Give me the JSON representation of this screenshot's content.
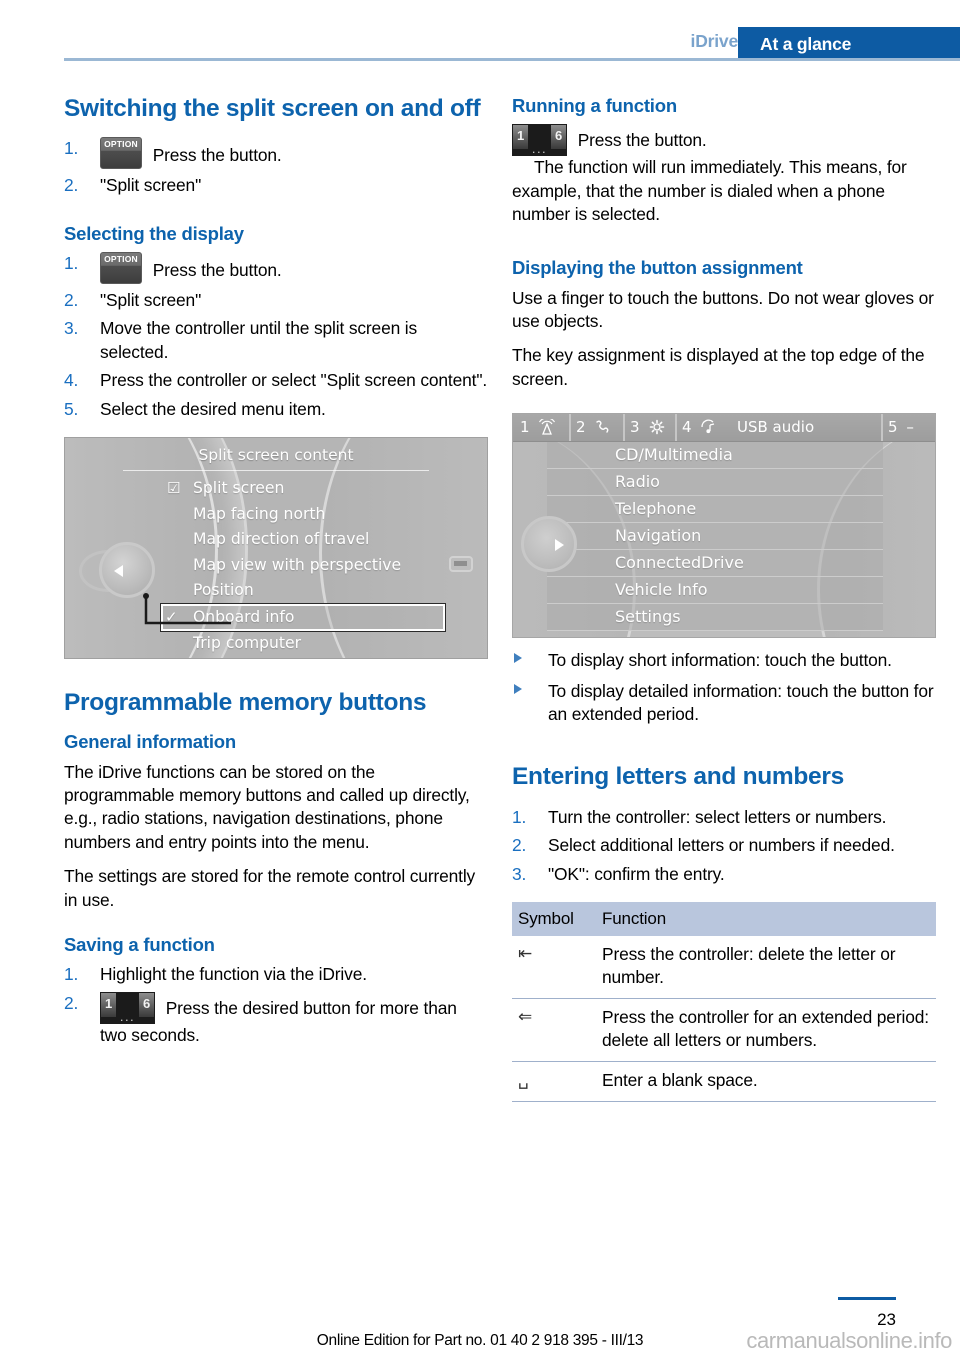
{
  "header": {
    "chapter": "iDrive",
    "tab": "At a glance"
  },
  "left_column": {
    "section1": {
      "title": "Switching the split screen on and off",
      "steps": [
        {
          "num": "1.",
          "icon": "option-button-icon",
          "text": "Press the button."
        },
        {
          "num": "2.",
          "text": "\"Split screen\""
        }
      ]
    },
    "section2": {
      "title": "Selecting the display",
      "steps": [
        {
          "num": "1.",
          "icon": "option-button-icon",
          "text": "Press the button."
        },
        {
          "num": "2.",
          "text": "\"Split screen\""
        },
        {
          "num": "3.",
          "text": "Move the controller until the split screen is selected."
        },
        {
          "num": "4.",
          "text": "Press the controller or select \"Split screen content\"."
        },
        {
          "num": "5.",
          "text": "Select the desired menu item."
        }
      ]
    },
    "screenshot": {
      "title": "Split screen content",
      "items": [
        {
          "label": "Split screen",
          "mark": "☑",
          "selected": false
        },
        {
          "label": "Map facing north",
          "mark": "",
          "selected": false
        },
        {
          "label": "Map direction of travel",
          "mark": "",
          "selected": false
        },
        {
          "label": "Map view with perspective",
          "mark": "",
          "selected": false
        },
        {
          "label": "Position",
          "mark": "",
          "selected": false
        },
        {
          "label": "Onboard info",
          "mark": "✓",
          "selected": true
        },
        {
          "label": "Trip computer",
          "mark": "",
          "selected": false
        }
      ]
    },
    "section3": {
      "title": "Programmable memory buttons",
      "sub1_title": "General information",
      "paragraphs": [
        "The iDrive functions can be stored on the programmable memory buttons and called up directly, e.g., radio stations, navigation destinations, phone numbers and entry points into the menu.",
        "The settings are stored for the remote control currently in use."
      ],
      "sub2_title": "Saving a function",
      "steps": [
        {
          "num": "1.",
          "text": "Highlight the function via the iDrive."
        },
        {
          "num": "2.",
          "icon": "memory-buttons-icon",
          "text": "Press the desired button for more than two seconds."
        }
      ]
    }
  },
  "right_column": {
    "section1": {
      "title": "Running a function",
      "icon": "memory-buttons-icon",
      "line1": "Press the button.",
      "paragraph": "The function will run immediately. This means, for example, that the number is dialed when a phone number is selected."
    },
    "section2": {
      "title": "Displaying the button assignment",
      "paragraphs": [
        "Use a finger to touch the buttons. Do not wear gloves or use objects.",
        "The key assignment is displayed at the top edge of the screen."
      ]
    },
    "screenshot": {
      "topbar": [
        {
          "num": "1",
          "icon": "antenna-icon"
        },
        {
          "num": "2",
          "icon": "telephone-icon"
        },
        {
          "num": "3",
          "icon": "gear-icon"
        },
        {
          "num": "4",
          "icon": "music-note-icon"
        }
      ],
      "topbar_label": "USB audio",
      "topbar_right": {
        "num": "5",
        "icon": "dash-icon",
        "dash": "–"
      },
      "items": [
        "CD/Multimedia",
        "Radio",
        "Telephone",
        "Navigation",
        "ConnectedDrive",
        "Vehicle Info",
        "Settings"
      ]
    },
    "bullets": [
      "To display short information: touch the button.",
      "To display detailed information: touch the button for an extended period."
    ],
    "section3": {
      "title": "Entering letters and numbers",
      "steps": [
        {
          "num": "1.",
          "text": "Turn the controller: select letters or numbers."
        },
        {
          "num": "2.",
          "text": "Select additional letters or numbers if needed."
        },
        {
          "num": "3.",
          "text": "\"OK\": confirm the entry."
        }
      ]
    },
    "table": {
      "headers": [
        "Symbol",
        "Function"
      ],
      "rows": [
        {
          "symbol": "⇤",
          "function": "Press the controller: delete the letter or number."
        },
        {
          "symbol": "⇐",
          "function": "Press the controller for an extended period: delete all letters or numbers."
        },
        {
          "symbol": "␣",
          "function": "Enter a blank space."
        }
      ]
    }
  },
  "footer": {
    "edition": "Online Edition for Part no. 01 40 2 918 395 - III/13",
    "page_number": "23",
    "watermark": "carmanualsonline.info"
  },
  "colors": {
    "heading_blue": "#0d63ad",
    "tab_blue": "#0d5ba3",
    "chapter_blue": "#7aa3cc",
    "rule_blue": "#9bb8d4",
    "table_header": "#b9c6dd",
    "number_blue": "#1a6fc0"
  }
}
